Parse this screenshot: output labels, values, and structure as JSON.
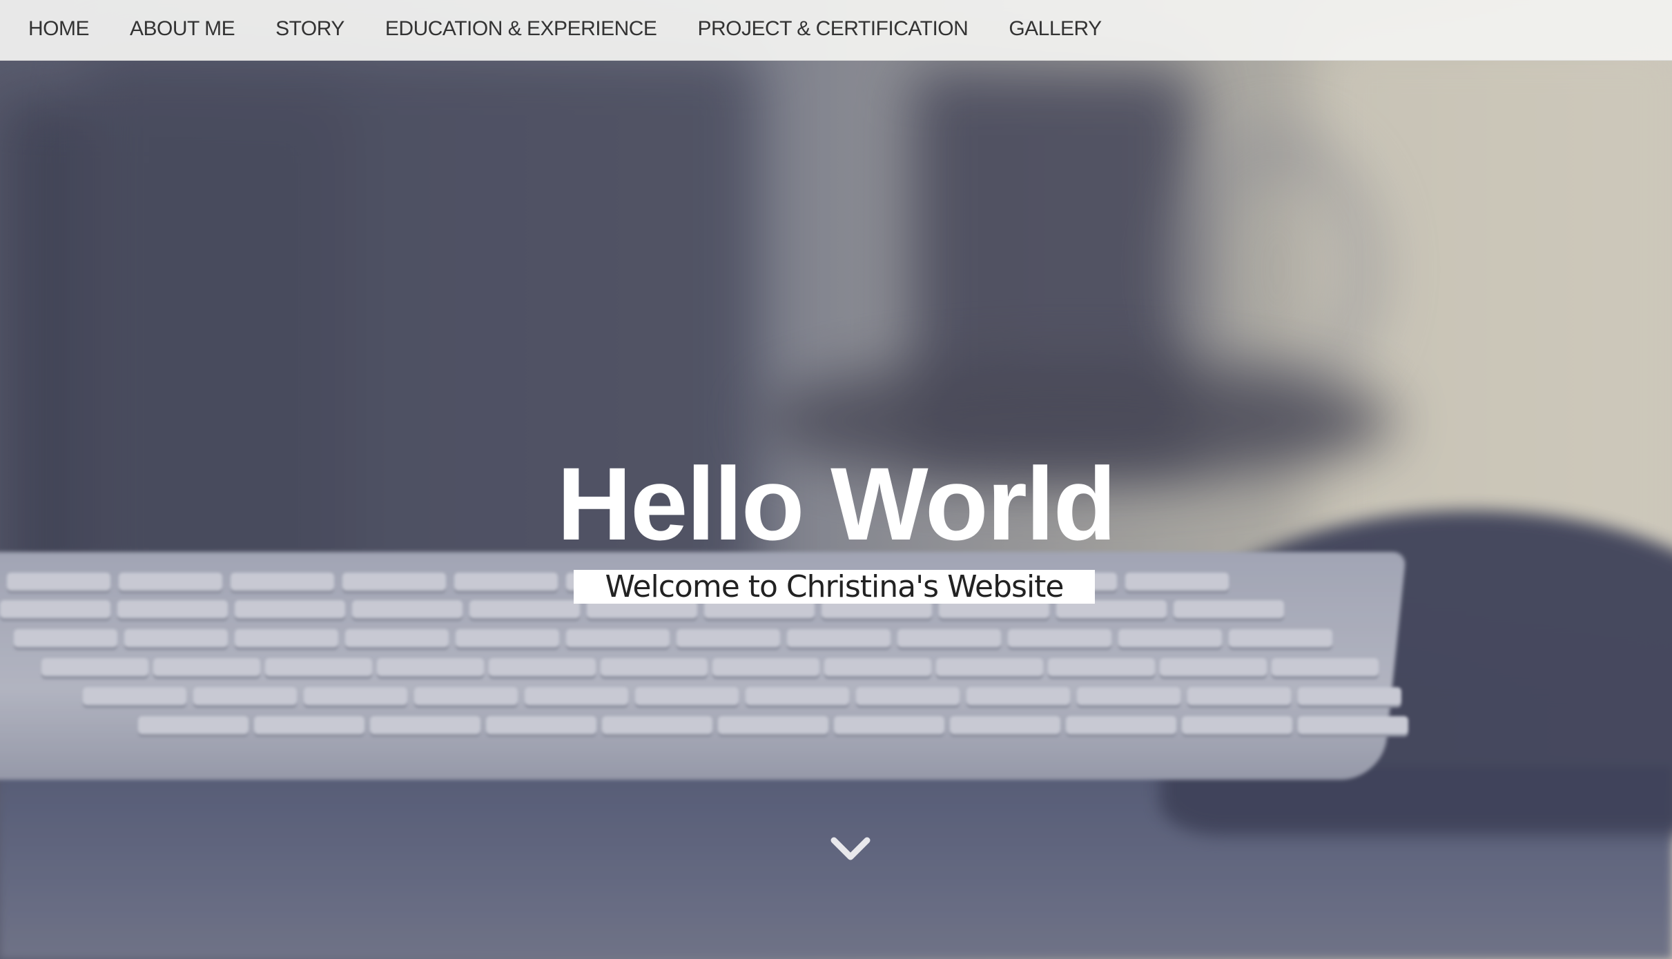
{
  "nav": {
    "items": [
      {
        "label": "HOME"
      },
      {
        "label": "ABOUT ME"
      },
      {
        "label": "STORY"
      },
      {
        "label": "EDUCATION & EXPERIENCE"
      },
      {
        "label": "PROJECT & CERTIFICATION"
      },
      {
        "label": "GALLERY"
      }
    ]
  },
  "hero": {
    "title": "Hello World",
    "subtitle": "Welcome to Christina's Website",
    "scroll_icon": "chevron-down-icon"
  },
  "colors": {
    "nav_background": "#f3f3f1",
    "nav_text": "#333333",
    "title_text": "#ffffff",
    "subtitle_background": "#ffffff",
    "subtitle_text": "#222222"
  }
}
